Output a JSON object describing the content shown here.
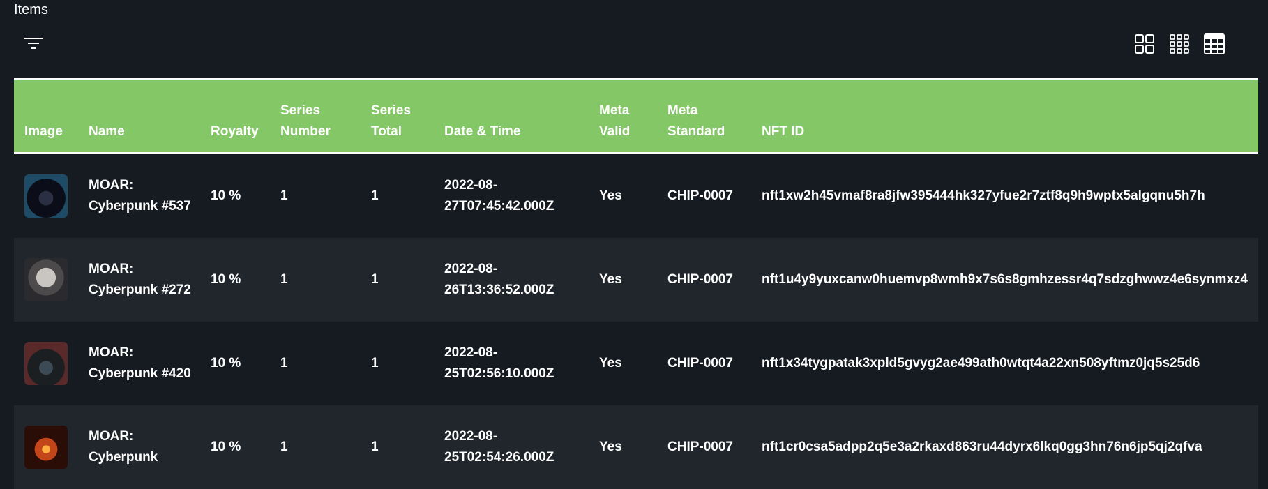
{
  "page": {
    "title": "Items"
  },
  "toolbar": {
    "icons": {
      "filter": "filter-icon",
      "grid_large": "grid-large-icon",
      "grid_small": "grid-small-icon",
      "table": "table-icon"
    }
  },
  "colors": {
    "background": "#161b22",
    "row_alt": "#21262d",
    "header": "#84c767",
    "text": "#ffffff"
  },
  "table": {
    "headers": [
      "Image",
      "Name",
      "Royalty",
      "Series Number",
      "Series Total",
      "Date & Time",
      "Meta Valid",
      "Meta Standard",
      "NFT ID"
    ],
    "rows": [
      {
        "name": "MOAR: Cyberpunk #537",
        "royalty": "10 %",
        "series_number": "1",
        "series_total": "1",
        "datetime": "2022-08-27T07:45:42.000Z",
        "meta_valid": "Yes",
        "meta_standard": "CHIP-0007",
        "nft_id": "nft1xw2h45vmaf8ra8jfw395444hk327yfue2r7ztf8q9h9wptx5algqnu5h7h"
      },
      {
        "name": "MOAR: Cyberpunk #272",
        "royalty": "10 %",
        "series_number": "1",
        "series_total": "1",
        "datetime": "2022-08-26T13:36:52.000Z",
        "meta_valid": "Yes",
        "meta_standard": "CHIP-0007",
        "nft_id": "nft1u4y9yuxcanw0huemvp8wmh9x7s6s8gmhzessr4q7sdzghwwz4e6synmxz4"
      },
      {
        "name": "MOAR: Cyberpunk #420",
        "royalty": "10 %",
        "series_number": "1",
        "series_total": "1",
        "datetime": "2022-08-25T02:56:10.000Z",
        "meta_valid": "Yes",
        "meta_standard": "CHIP-0007",
        "nft_id": "nft1x34tygpatak3xpld5gvyg2ae499ath0wtqt4a22xn508yftmz0jq5s25d6"
      },
      {
        "name": "MOAR: Cyberpunk",
        "royalty": "10 %",
        "series_number": "1",
        "series_total": "1",
        "datetime": "2022-08-25T02:54:26.000Z",
        "meta_valid": "Yes",
        "meta_standard": "CHIP-0007",
        "nft_id": "nft1cr0csa5adpp2q5e3a2rkaxd863ru44dyrx6lkq0gg3hn76n6jp5qj2qfva"
      }
    ]
  }
}
